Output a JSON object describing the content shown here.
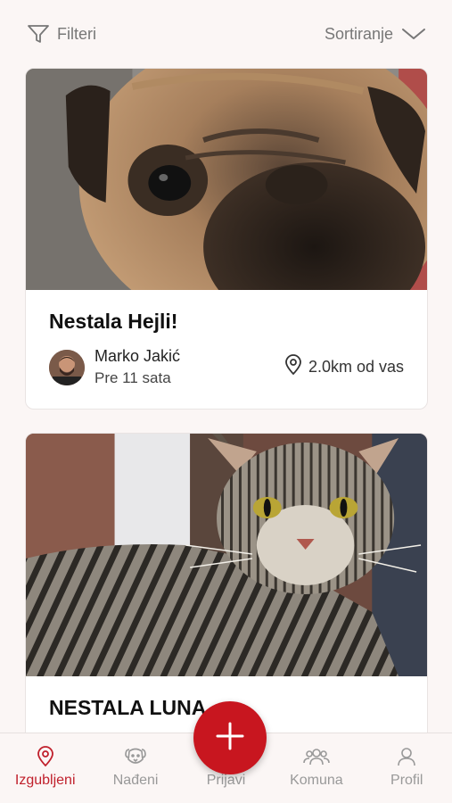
{
  "filters": {
    "label": "Filteri",
    "icon": "filter-icon"
  },
  "sort": {
    "label": "Sortiranje",
    "icon": "chevron-down-icon"
  },
  "posts": [
    {
      "title": "Nestala Hejli!",
      "image": "pug-photo",
      "author": "Marko Jakić",
      "time": "Pre 11 sata",
      "distance": "2.0km od vas"
    },
    {
      "title": "NESTALA LUNA",
      "image": "tabby-cat-photo"
    }
  ],
  "fab": {
    "icon": "plus-icon"
  },
  "tabs": [
    {
      "label": "Izgubljeni",
      "icon": "location-pin-icon",
      "active": true
    },
    {
      "label": "Nađeni",
      "icon": "dog-face-icon",
      "active": false
    },
    {
      "label": "Prijavi",
      "icon": "",
      "active": false
    },
    {
      "label": "Komuna",
      "icon": "community-icon",
      "active": false
    },
    {
      "label": "Profil",
      "icon": "user-icon",
      "active": false
    }
  ],
  "colors": {
    "accent": "#c8161f",
    "background": "#fbf6f5",
    "inactive": "#999999"
  }
}
